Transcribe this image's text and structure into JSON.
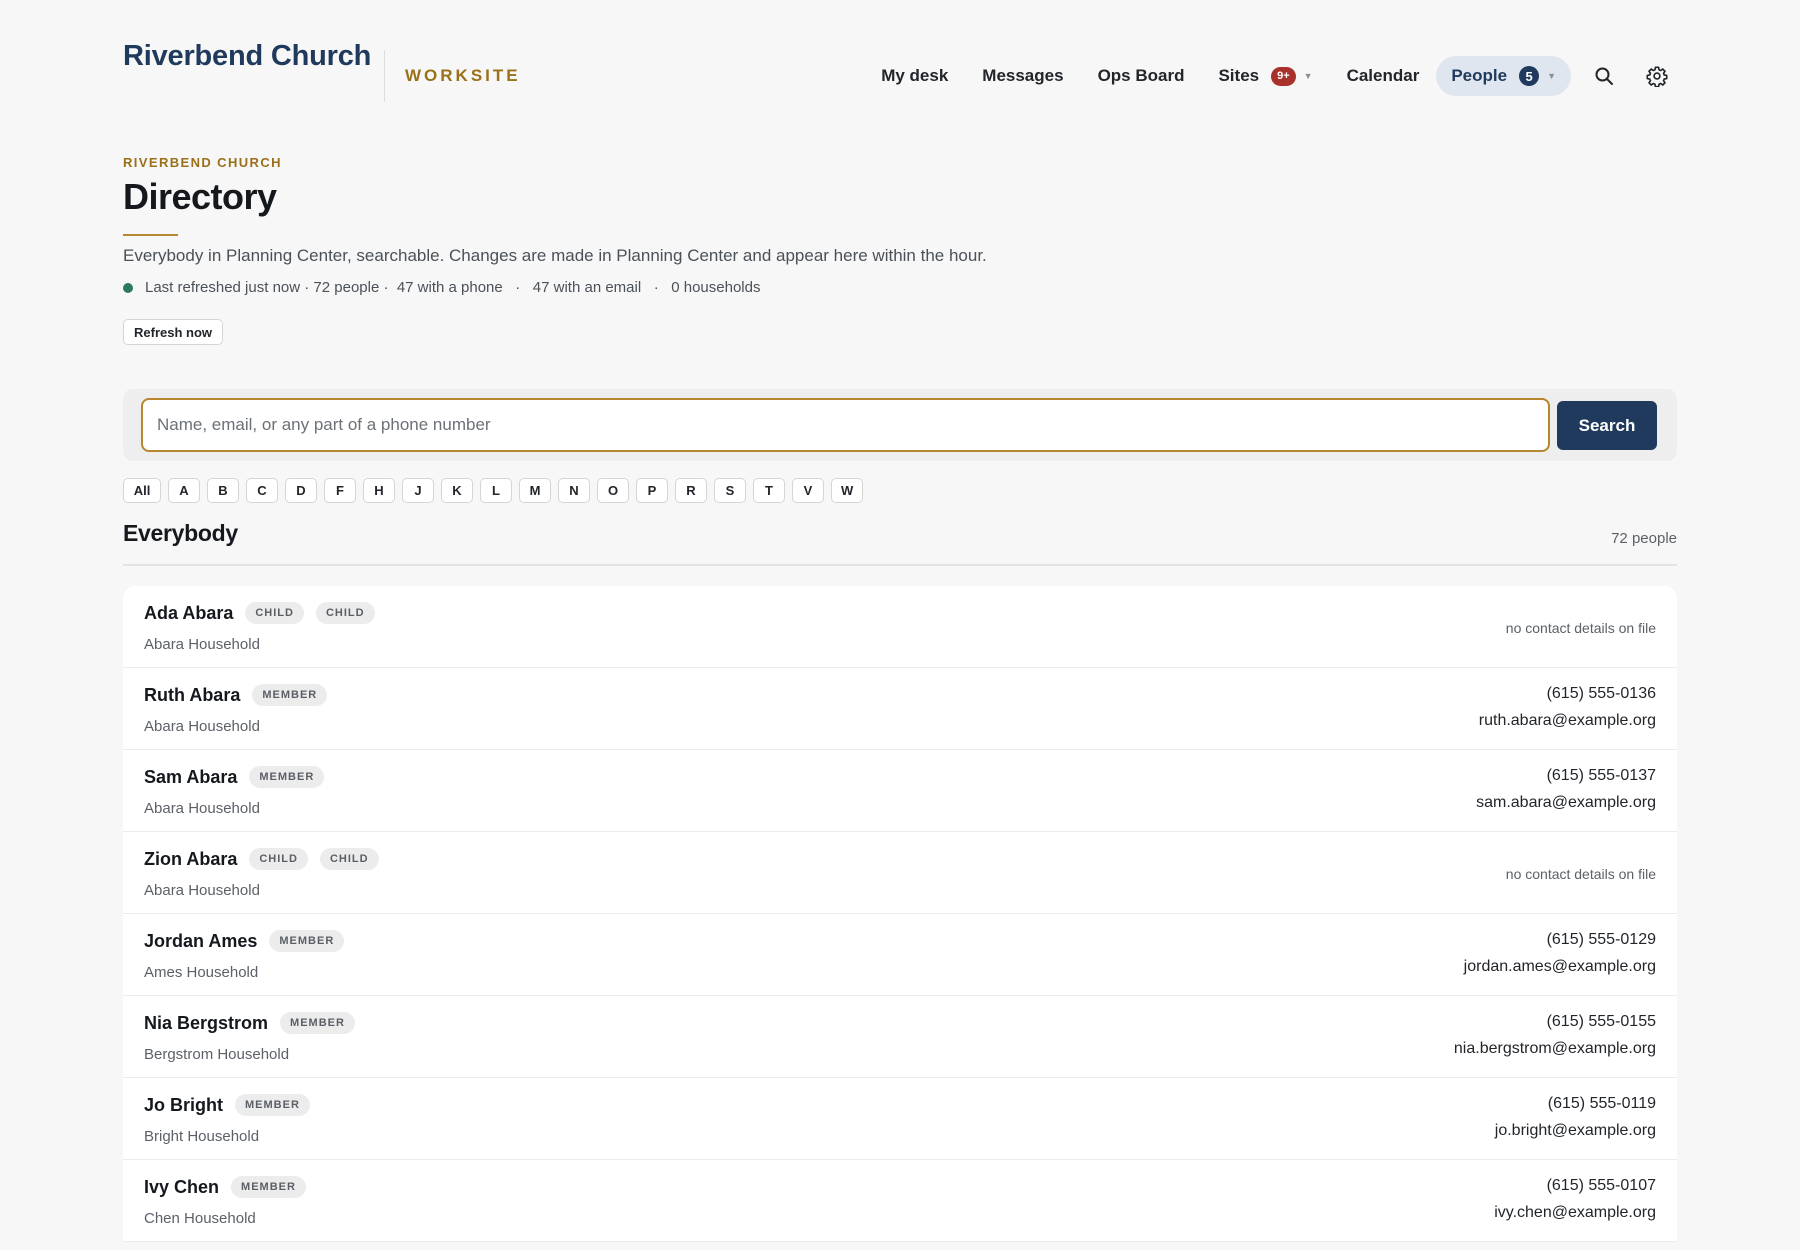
{
  "header": {
    "brand": "Riverbend Church",
    "subtitle": "WORKSITE",
    "nav": [
      {
        "label": "My desk"
      },
      {
        "label": "Messages"
      },
      {
        "label": "Ops Board"
      },
      {
        "label": "Sites",
        "badge": "9+"
      },
      {
        "label": "Calendar"
      },
      {
        "label": "People",
        "badge": "5"
      }
    ],
    "icons": {
      "search": "search-icon",
      "settings": "gear-icon"
    }
  },
  "page": {
    "eyebrow": "RIVERBEND CHURCH",
    "title": "Directory",
    "description": "Everybody in Planning Center, searchable. Changes are made in Planning Center and appear here within the hour.",
    "status": {
      "refreshed": "Last refreshed just now · 72 people ·",
      "phones": "47 with a phone",
      "emails": "47 with an email",
      "households": "0 households",
      "sep": "·"
    },
    "refresh_label": "Refresh now"
  },
  "search": {
    "placeholder": "Name, email, or any part of a phone number",
    "value": "",
    "button": "Search"
  },
  "letters": [
    "All",
    "A",
    "B",
    "C",
    "D",
    "F",
    "H",
    "J",
    "K",
    "L",
    "M",
    "N",
    "O",
    "P",
    "R",
    "S",
    "T",
    "V",
    "W"
  ],
  "section": {
    "title": "Everybody",
    "count": "72 people"
  },
  "people": [
    {
      "name": "Ada Abara",
      "tags": [
        "CHILD",
        "CHILD"
      ],
      "household": "Abara Household",
      "phone": "",
      "email": "",
      "no_contact": "no contact details on file"
    },
    {
      "name": "Ruth Abara",
      "tags": [
        "MEMBER"
      ],
      "household": "Abara Household",
      "phone": "(615) 555-0136",
      "email": "ruth.abara@example.org"
    },
    {
      "name": "Sam Abara",
      "tags": [
        "MEMBER"
      ],
      "household": "Abara Household",
      "phone": "(615) 555-0137",
      "email": "sam.abara@example.org"
    },
    {
      "name": "Zion Abara",
      "tags": [
        "CHILD",
        "CHILD"
      ],
      "household": "Abara Household",
      "phone": "",
      "email": "",
      "no_contact": "no contact details on file"
    },
    {
      "name": "Jordan Ames",
      "tags": [
        "MEMBER"
      ],
      "household": "Ames Household",
      "phone": "(615) 555-0129",
      "email": "jordan.ames@example.org"
    },
    {
      "name": "Nia Bergstrom",
      "tags": [
        "MEMBER"
      ],
      "household": "Bergstrom Household",
      "phone": "(615) 555-0155",
      "email": "nia.bergstrom@example.org"
    },
    {
      "name": "Jo Bright",
      "tags": [
        "MEMBER"
      ],
      "household": "Bright Household",
      "phone": "(615) 555-0119",
      "email": "jo.bright@example.org"
    },
    {
      "name": "Ivy Chen",
      "tags": [
        "MEMBER"
      ],
      "household": "Chen Household",
      "phone": "(615) 555-0107",
      "email": "ivy.chen@example.org"
    }
  ],
  "colors": {
    "brand": "#1f3a5c",
    "accent": "#b8862e",
    "badge_red": "#a8322b",
    "status_dot": "#2c7a5b"
  }
}
